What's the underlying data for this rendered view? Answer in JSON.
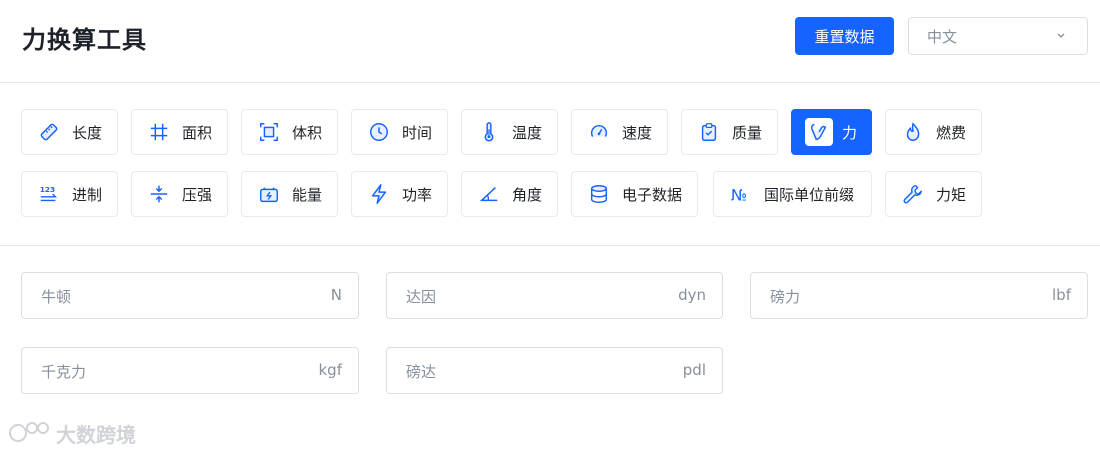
{
  "header": {
    "title": "力换算工具",
    "reset_label": "重置数据",
    "language": "中文"
  },
  "categories": [
    {
      "label": "长度",
      "icon": "ruler-icon"
    },
    {
      "label": "面积",
      "icon": "hash-icon"
    },
    {
      "label": "体积",
      "icon": "cube-frame-icon"
    },
    {
      "label": "时间",
      "icon": "clock-icon"
    },
    {
      "label": "温度",
      "icon": "thermometer-icon"
    },
    {
      "label": "速度",
      "icon": "speedometer-icon"
    },
    {
      "label": "质量",
      "icon": "clipboard-check-icon"
    },
    {
      "label": "力",
      "icon": "hand-heart-icon",
      "active": true
    },
    {
      "label": "燃费",
      "icon": "flame-icon"
    },
    {
      "label": "进制",
      "icon": "numbers-icon"
    },
    {
      "label": "压强",
      "icon": "compress-icon"
    },
    {
      "label": "能量",
      "icon": "battery-charge-icon"
    },
    {
      "label": "功率",
      "icon": "lightning-icon"
    },
    {
      "label": "角度",
      "icon": "angle-icon"
    },
    {
      "label": "电子数据",
      "icon": "database-icon"
    },
    {
      "label": "国际单位前缀",
      "icon": "numero-icon"
    },
    {
      "label": "力矩",
      "icon": "wrench-icon"
    }
  ],
  "fields": [
    {
      "label": "牛顿",
      "unit": "N"
    },
    {
      "label": "达因",
      "unit": "dyn"
    },
    {
      "label": "磅力",
      "unit": "lbf"
    },
    {
      "label": "千克力",
      "unit": "kgf"
    },
    {
      "label": "磅达",
      "unit": "pdl"
    }
  ],
  "watermark": "大数跨境",
  "colors": {
    "accent": "#1664ff",
    "border": "#dcdfe6",
    "placeholder": "#86909c"
  }
}
